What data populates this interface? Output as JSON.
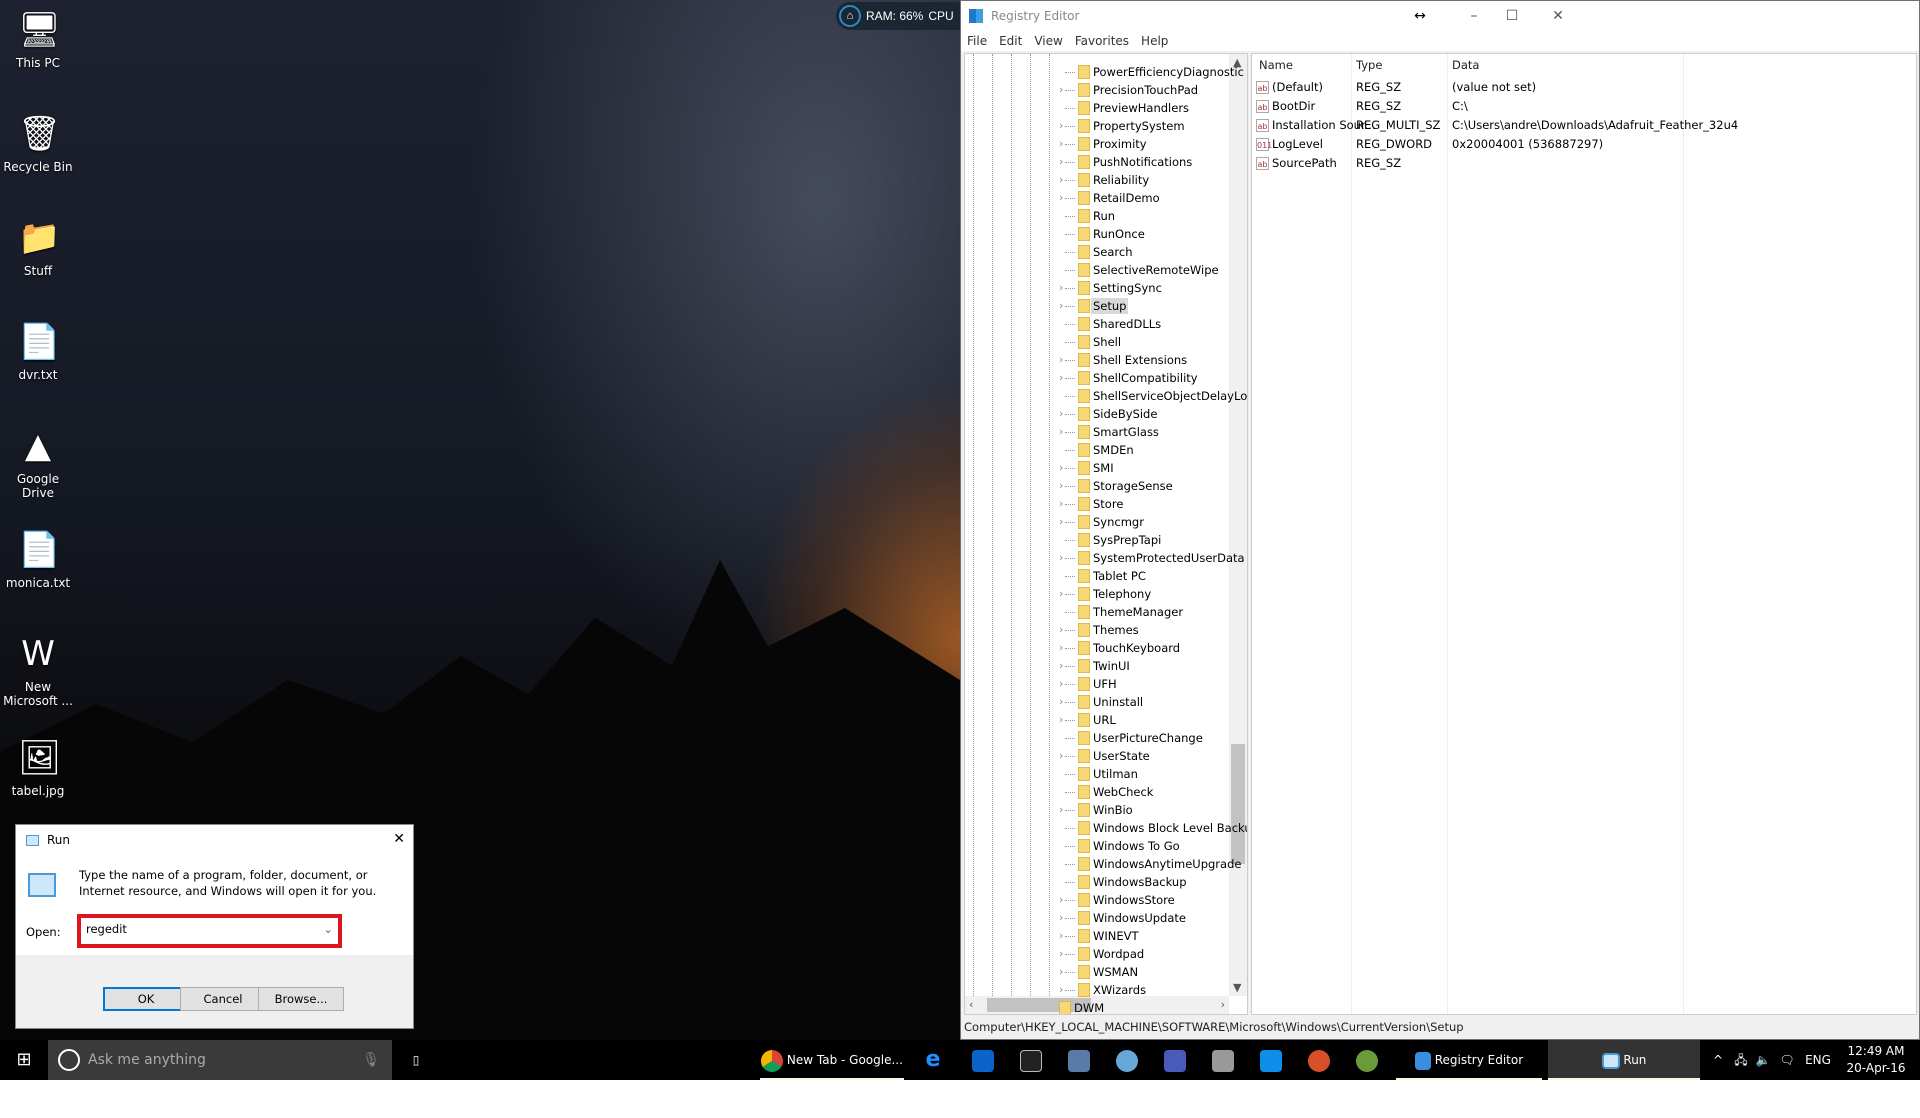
{
  "desktop": {
    "icons": [
      {
        "label": "This PC",
        "icon": "computer-icon",
        "glyph": "🖥"
      },
      {
        "label": "Recycle Bin",
        "icon": "recycle-bin-icon",
        "glyph": "🗑"
      },
      {
        "label": "Stuff",
        "icon": "folder-icon",
        "glyph": "📁"
      },
      {
        "label": "dvr.txt",
        "icon": "text-file-icon",
        "glyph": "📄"
      },
      {
        "label": "Google Drive",
        "icon": "google-drive-icon",
        "glyph": "▲"
      },
      {
        "label": "monica.txt",
        "icon": "text-file-icon",
        "glyph": "📄"
      },
      {
        "label": "New Microsoft ...",
        "icon": "word-document-icon",
        "glyph": "W"
      },
      {
        "label": "tabel.jpg",
        "icon": "image-file-icon",
        "glyph": "🖼"
      }
    ]
  },
  "widget": {
    "ram": "RAM: 66%",
    "cpu": "CPU"
  },
  "regedit": {
    "title": "Registry Editor",
    "menu": [
      "File",
      "Edit",
      "View",
      "Favorites",
      "Help"
    ],
    "tree": [
      {
        "label": "PowerEfficiencyDiagnostic",
        "children": false
      },
      {
        "label": "PrecisionTouchPad",
        "children": true
      },
      {
        "label": "PreviewHandlers",
        "children": false
      },
      {
        "label": "PropertySystem",
        "children": true
      },
      {
        "label": "Proximity",
        "children": true
      },
      {
        "label": "PushNotifications",
        "children": true
      },
      {
        "label": "Reliability",
        "children": true
      },
      {
        "label": "RetailDemo",
        "children": true
      },
      {
        "label": "Run",
        "children": false
      },
      {
        "label": "RunOnce",
        "children": false
      },
      {
        "label": "Search",
        "children": false
      },
      {
        "label": "SelectiveRemoteWipe",
        "children": false
      },
      {
        "label": "SettingSync",
        "children": true
      },
      {
        "label": "Setup",
        "children": true,
        "selected": true
      },
      {
        "label": "SharedDLLs",
        "children": false
      },
      {
        "label": "Shell",
        "children": false
      },
      {
        "label": "Shell Extensions",
        "children": true
      },
      {
        "label": "ShellCompatibility",
        "children": true
      },
      {
        "label": "ShellServiceObjectDelayLoad",
        "children": false
      },
      {
        "label": "SideBySide",
        "children": true
      },
      {
        "label": "SmartGlass",
        "children": true
      },
      {
        "label": "SMDEn",
        "children": false
      },
      {
        "label": "SMI",
        "children": true
      },
      {
        "label": "StorageSense",
        "children": true
      },
      {
        "label": "Store",
        "children": true
      },
      {
        "label": "Syncmgr",
        "children": true
      },
      {
        "label": "SysPrepTapi",
        "children": false
      },
      {
        "label": "SystemProtectedUserData",
        "children": true
      },
      {
        "label": "Tablet PC",
        "children": false
      },
      {
        "label": "Telephony",
        "children": true
      },
      {
        "label": "ThemeManager",
        "children": false
      },
      {
        "label": "Themes",
        "children": true
      },
      {
        "label": "TouchKeyboard",
        "children": true
      },
      {
        "label": "TwinUI",
        "children": true
      },
      {
        "label": "UFH",
        "children": true
      },
      {
        "label": "Uninstall",
        "children": true
      },
      {
        "label": "URL",
        "children": true
      },
      {
        "label": "UserPictureChange",
        "children": false
      },
      {
        "label": "UserState",
        "children": true
      },
      {
        "label": "Utilman",
        "children": false
      },
      {
        "label": "WebCheck",
        "children": false
      },
      {
        "label": "WinBio",
        "children": true
      },
      {
        "label": "Windows Block Level Backup",
        "children": false
      },
      {
        "label": "Windows To Go",
        "children": false
      },
      {
        "label": "WindowsAnytimeUpgrade",
        "children": false
      },
      {
        "label": "WindowsBackup",
        "children": false
      },
      {
        "label": "WindowsStore",
        "children": true
      },
      {
        "label": "WindowsUpdate",
        "children": true
      },
      {
        "label": "WINEVT",
        "children": true
      },
      {
        "label": "Wordpad",
        "children": true
      },
      {
        "label": "WSMAN",
        "children": true
      },
      {
        "label": "XWizards",
        "children": true
      },
      {
        "label": "DWM",
        "children": false,
        "parent_level": true
      }
    ],
    "columns": [
      "Name",
      "Type",
      "Data"
    ],
    "values": [
      {
        "name": "(Default)",
        "type": "REG_SZ",
        "data": "(value not set)",
        "icon": "ab"
      },
      {
        "name": "BootDir",
        "type": "REG_SZ",
        "data": "C:\\",
        "icon": "ab"
      },
      {
        "name": "Installation Sour...",
        "type": "REG_MULTI_SZ",
        "data": "C:\\Users\\andre\\Downloads\\Adafruit_Feather_32u4",
        "icon": "ab"
      },
      {
        "name": "LogLevel",
        "type": "REG_DWORD",
        "data": "0x20004001 (536887297)",
        "icon": "011"
      },
      {
        "name": "SourcePath",
        "type": "REG_SZ",
        "data": "",
        "icon": "ab"
      }
    ],
    "status": "Computer\\HKEY_LOCAL_MACHINE\\SOFTWARE\\Microsoft\\Windows\\CurrentVersion\\Setup"
  },
  "run": {
    "title": "Run",
    "description": "Type the name of a program, folder, document, or Internet resource, and Windows will open it for you.",
    "open_label": "Open:",
    "value": "regedit",
    "ok": "OK",
    "cancel": "Cancel",
    "browse": "Browse..."
  },
  "taskbar": {
    "search_placeholder": "Ask me anything",
    "chrome": "New Tab - Google...",
    "regedit": "Registry Editor",
    "run": "Run",
    "lang": "ENG",
    "time": "12:49 AM",
    "date": "20-Apr-16"
  }
}
